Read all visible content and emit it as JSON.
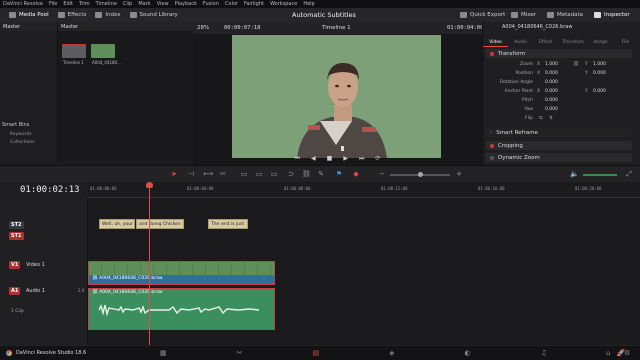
{
  "menu": [
    "DaVinci Resolve",
    "File",
    "Edit",
    "Trim",
    "Timeline",
    "Clip",
    "Mark",
    "View",
    "Playback",
    "Fusion",
    "Color",
    "Fairlight",
    "Workspace",
    "Help"
  ],
  "toolbar": {
    "media_pool": "Media Pool",
    "effects": "Effects",
    "index": "Index",
    "sound_library": "Sound Library",
    "project_title": "Automatic Subtitles",
    "quick_export": "Quick Export",
    "mixer": "Mixer",
    "metadata": "Metadata",
    "inspector": "Inspector"
  },
  "left_panel": {
    "master": "Master",
    "smart_bins": "Smart Bins",
    "keywords": "Keywords",
    "collections": "Collections"
  },
  "media_pool": {
    "header": "Master",
    "clips": [
      {
        "name": "Timeline 1",
        "color": "#6b6b6e"
      },
      {
        "name": "A004_04180...",
        "color": "#5f8f5a"
      }
    ]
  },
  "viewer": {
    "zoom": "28%",
    "source_timecode": "00:00:07:18",
    "timeline_name": "Timeline 1",
    "record_timecode": "01:00:04:00"
  },
  "inspector": {
    "clip_name": "A004_04180646_C026.braw",
    "tabs": [
      "Video",
      "Audio",
      "Effect",
      "Transition",
      "Image",
      "File"
    ],
    "transform_label": "Transform",
    "rows": [
      {
        "label": "Zoom",
        "x": "1.000",
        "y": "1.000"
      },
      {
        "label": "Position",
        "x": "0.000",
        "y": "0.000"
      },
      {
        "label": "Rotation Angle",
        "x": "0.000",
        "y": ""
      },
      {
        "label": "Anchor Point",
        "x": "0.000",
        "y": "0.000"
      },
      {
        "label": "Pitch",
        "x": "0.000",
        "y": ""
      },
      {
        "label": "Yaw",
        "x": "0.000",
        "y": ""
      },
      {
        "label": "Flip",
        "x": "",
        "y": ""
      }
    ],
    "smart_reframe": "Smart Reframe",
    "cropping": "Cropping",
    "dynamic_zoom": "Dynamic Zoom"
  },
  "timeline": {
    "timecode": "01:00:02:13",
    "ruler_ticks": [
      "01:00:00:00",
      "01:00:04:00",
      "01:00:08:00",
      "01:00:12:00",
      "01:00:16:00",
      "01:00:20:00"
    ],
    "tracks": {
      "st2": "ST2",
      "st1": "ST1",
      "v1": "V1",
      "video1": "Video 1",
      "a1": "A1",
      "audio1": "Audio 1",
      "audio_channel": "2.0",
      "audio_clip_count": "1 Clip"
    },
    "subtitles": [
      "Well, uh, your",
      "and doing Chicken",
      "The rest is just"
    ],
    "video_clip_name": "A004_04180646_C026.braw",
    "audio_clip_name": "A004_04180646_C026.braw"
  },
  "status": {
    "app_name": "DaVinci Resolve Studio 18.6"
  },
  "colors": {
    "accent_red": "#e54848",
    "video_clip": "#4d8a63",
    "audio_clip": "#3b8f5f",
    "subtitle_clip": "#d8cba2"
  }
}
